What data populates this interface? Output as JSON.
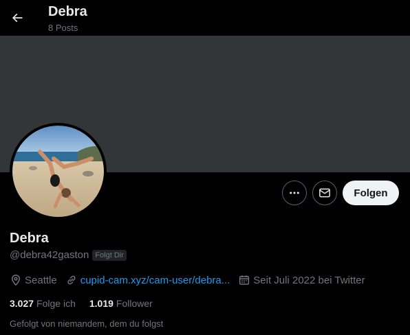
{
  "header": {
    "name": "Debra",
    "posts": "8 Posts"
  },
  "profile": {
    "name": "Debra",
    "handle": "@debra42gaston",
    "follows_you_badge": "Folgt Dir",
    "location": "Seattle",
    "website": "cupid-cam.xyz/cam-user/debra...",
    "joined": "Seit Juli 2022 bei Twitter",
    "following_count": "3.027",
    "following_label": "Folge ich",
    "followers_count": "1.019",
    "followers_label": "Follower",
    "followed_by": "Gefolgt von niemandem, dem du folgst"
  },
  "actions": {
    "follow_label": "Folgen",
    "more_icon": "more-horizontal-icon",
    "dm_icon": "envelope-icon",
    "back_icon": "arrow-left-icon"
  },
  "colors": {
    "background": "#000000",
    "banner": "#333639",
    "link": "#1d9bf0",
    "secondary_text": "#71767b",
    "primary_text": "#e7e9ea",
    "follow_button_bg": "#eff3f4"
  }
}
